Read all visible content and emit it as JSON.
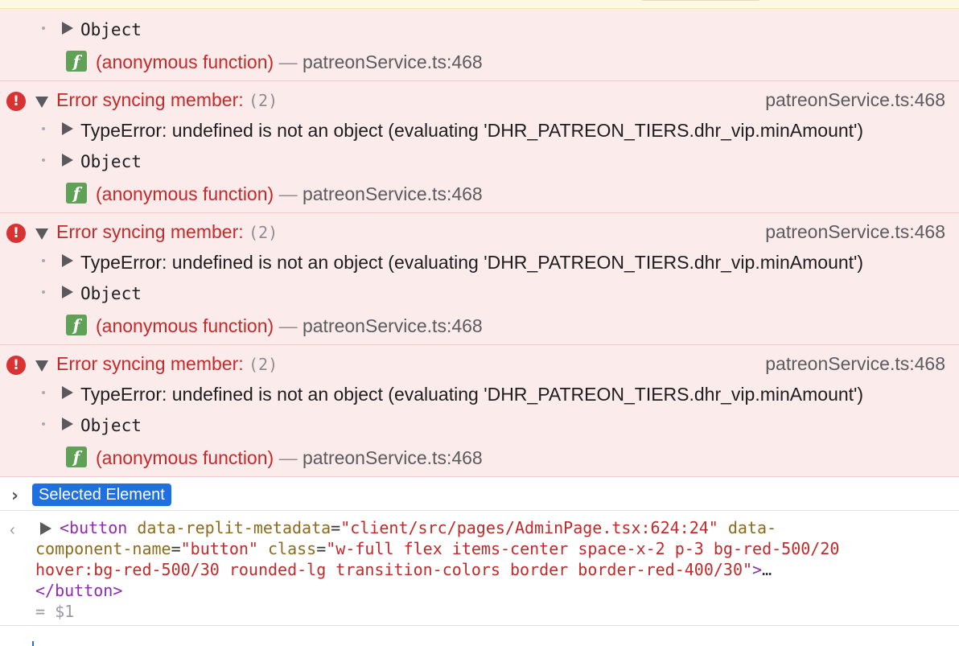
{
  "prev_error": {
    "object_label": "Object",
    "stack": {
      "fn": "(anonymous function)",
      "sep": "—",
      "src": "patreonService.ts:468"
    }
  },
  "errors": [
    {
      "title": "Error syncing member:",
      "count": "(2)",
      "source": "patreonService.ts:468",
      "type_error": "TypeError: undefined is not an object (evaluating 'DHR_PATREON_TIERS.dhr_vip.minAmount')",
      "object_label": "Object",
      "stack": {
        "fn": "(anonymous function)",
        "sep": "—",
        "src": "patreonService.ts:468"
      }
    },
    {
      "title": "Error syncing member:",
      "count": "(2)",
      "source": "patreonService.ts:468",
      "type_error": "TypeError: undefined is not an object (evaluating 'DHR_PATREON_TIERS.dhr_vip.minAmount')",
      "object_label": "Object",
      "stack": {
        "fn": "(anonymous function)",
        "sep": "—",
        "src": "patreonService.ts:468"
      }
    },
    {
      "title": "Error syncing member:",
      "count": "(2)",
      "source": "patreonService.ts:468",
      "type_error": "TypeError: undefined is not an object (evaluating 'DHR_PATREON_TIERS.dhr_vip.minAmount')",
      "object_label": "Object",
      "stack": {
        "fn": "(anonymous function)",
        "sep": "—",
        "src": "patreonService.ts:468"
      }
    }
  ],
  "selected": {
    "chevron": "›",
    "badge": "Selected Element"
  },
  "output": {
    "arrow": "‹",
    "open_tag": "<button",
    "attr1_name": " data-replit-metadata",
    "attr1_eq": "=",
    "attr1_val": "\"client/src/pages/AdminPage.tsx:624:24\"",
    "attr2_name_a": " data-",
    "attr2_name_b": "component-name",
    "attr2_eq": "=",
    "attr2_val": "\"button\"",
    "attr3_name": " class",
    "attr3_eq": "=",
    "attr3_val_a": "\"w-full flex items-center space-x-2 p-3 bg-red-500/20",
    "attr3_val_b": "hover:bg-red-500/30 rounded-lg transition-colors border border-red-400/30\"",
    "close_bracket": ">",
    "ellipsis": "…",
    "close_tag": "</button>",
    "result": "= $1"
  },
  "colors": {
    "error_bg": "#fbebeb",
    "error_text": "#c52a2a",
    "badge_bg": "#1f6fe0",
    "fn_icon": "#5fa156"
  },
  "icons": [
    "error-icon",
    "disclosure-triangle-icon",
    "function-icon",
    "chevron-right-icon",
    "output-arrow-icon"
  ]
}
